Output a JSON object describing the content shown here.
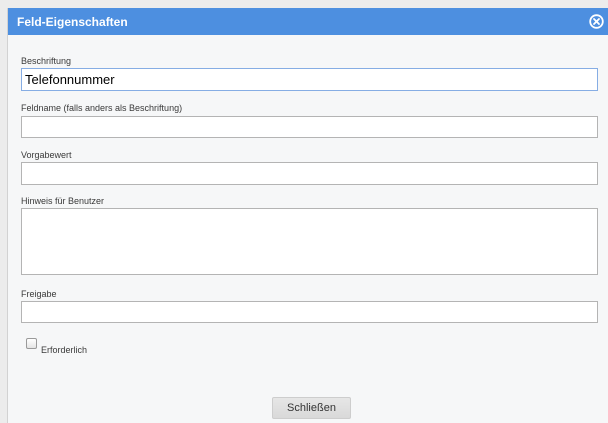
{
  "dialog": {
    "title": "Feld-Eigenschaften",
    "close_icon": "close-circle-icon"
  },
  "fields": {
    "caption": {
      "label": "Beschriftung",
      "value": "Telefonnummer"
    },
    "field_name": {
      "label": "Feldname (falls anders als Beschriftung)",
      "value": ""
    },
    "default_value": {
      "label": "Vorgabewert",
      "value": ""
    },
    "user_hint": {
      "label": "Hinweis für Benutzer",
      "value": ""
    },
    "release": {
      "label": "Freigabe",
      "value": ""
    }
  },
  "required": {
    "label": "Erforderlich",
    "checked": false
  },
  "footer": {
    "close_label": "Schließen"
  },
  "colors": {
    "titlebar": "#4d8fe0",
    "title_text": "#ffffff",
    "dialog_background": "#f6f7f8",
    "focused_border": "#86ade4",
    "button_background": "#dedede"
  }
}
